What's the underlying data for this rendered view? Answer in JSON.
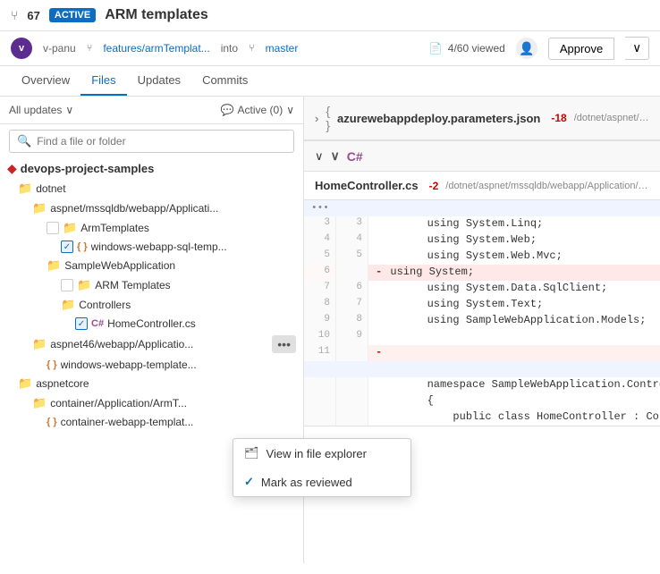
{
  "topbar": {
    "pr_icon": "⑂",
    "pr_count": "67",
    "active_badge": "ACTIVE",
    "pr_title": "ARM templates"
  },
  "subbar": {
    "avatar_text": "v",
    "author": "v-panu",
    "branch_from": "features/armTemplat...",
    "into": "into",
    "branch_to": "master",
    "viewed": "4/60 viewed",
    "approve_label": "Approve",
    "dropdown_arrow": "∨"
  },
  "nav": {
    "tabs": [
      "Overview",
      "Files",
      "Updates",
      "Commits"
    ],
    "active": "Files"
  },
  "left": {
    "filter_label": "All updates",
    "comment_label": "Active (0)",
    "search_placeholder": "Find a file or folder",
    "files": [
      {
        "indent": 0,
        "type": "root",
        "icon": "diamond",
        "label": "devops-project-samples"
      },
      {
        "indent": 1,
        "type": "folder",
        "label": "dotnet"
      },
      {
        "indent": 2,
        "type": "folder",
        "label": "aspnet/mssqldb/webapp/Applicati..."
      },
      {
        "indent": 3,
        "type": "folder",
        "label": "ArmTemplates",
        "checked": false
      },
      {
        "indent": 4,
        "type": "json",
        "label": "windows-webapp-sql-temp...",
        "checked": true
      },
      {
        "indent": 3,
        "type": "folder",
        "label": "SampleWebApplication"
      },
      {
        "indent": 4,
        "type": "folder",
        "label": "ARM Templates",
        "checked": false
      },
      {
        "indent": 4,
        "type": "folder",
        "label": "Controllers"
      },
      {
        "indent": 5,
        "type": "cs",
        "label": "HomeController.cs",
        "checked": true
      },
      {
        "indent": 2,
        "type": "folder",
        "label": "aspnet46/webapp/Applicatio...",
        "has_dots": true
      },
      {
        "indent": 3,
        "type": "json",
        "label": "windows-webapp-template..."
      },
      {
        "indent": 1,
        "type": "folder",
        "label": "aspnetcore"
      },
      {
        "indent": 2,
        "type": "folder",
        "label": "container/Application/ArmT..."
      },
      {
        "indent": 3,
        "type": "json",
        "label": "container-webapp-templat..."
      }
    ]
  },
  "context_menu": {
    "items": [
      {
        "icon": "🗂",
        "label": "View in file explorer"
      },
      {
        "icon": "✓",
        "label": "Mark as reviewed"
      }
    ]
  },
  "right": {
    "file1": {
      "expand": "›",
      "brackets": "{ }",
      "name": "azurewebappdeploy.parameters.json",
      "diff": "-18",
      "path": "/dotnet/aspnet/mssqldb/webapp/Application/SampleWebApplicati..."
    },
    "file2": {
      "expand": "∨",
      "lang": "C#",
      "name": "HomeController.cs",
      "diff": "-2",
      "path": "/dotnet/aspnet/mssqldb/webapp/Application/SampleWebApplicati...",
      "lines": [
        {
          "old": "",
          "new": "",
          "type": "separator",
          "content": "..."
        },
        {
          "old": "3",
          "new": "3",
          "type": "normal",
          "content": "        using System.Linq;"
        },
        {
          "old": "4",
          "new": "4",
          "type": "normal",
          "content": "        using System.Web;"
        },
        {
          "old": "5",
          "new": "5",
          "type": "normal",
          "content": "        using System.Web.Mvc;"
        },
        {
          "old": "6",
          "new": "",
          "type": "deleted",
          "content": "        using System;"
        },
        {
          "old": "7",
          "new": "6",
          "type": "normal",
          "content": "        using System.Data.SqlClient;"
        },
        {
          "old": "8",
          "new": "7",
          "type": "normal",
          "content": "        using System.Text;"
        },
        {
          "old": "9",
          "new": "8",
          "type": "normal",
          "content": "        using SampleWebApplication.Models;"
        },
        {
          "old": "10",
          "new": "9",
          "type": "normal",
          "content": ""
        },
        {
          "old": "11",
          "new": "",
          "type": "sep2",
          "content": ""
        },
        {
          "old": "",
          "new": "",
          "type": "separator2",
          "content": ""
        },
        {
          "old": "",
          "new": "",
          "type": "ns",
          "content": "        namespace SampleWebApplication.Contro..."
        },
        {
          "old": "",
          "new": "",
          "type": "ns2",
          "content": "        {"
        },
        {
          "old": "",
          "new": "",
          "type": "ns3",
          "content": "            public class HomeController : Co..."
        }
      ]
    }
  }
}
